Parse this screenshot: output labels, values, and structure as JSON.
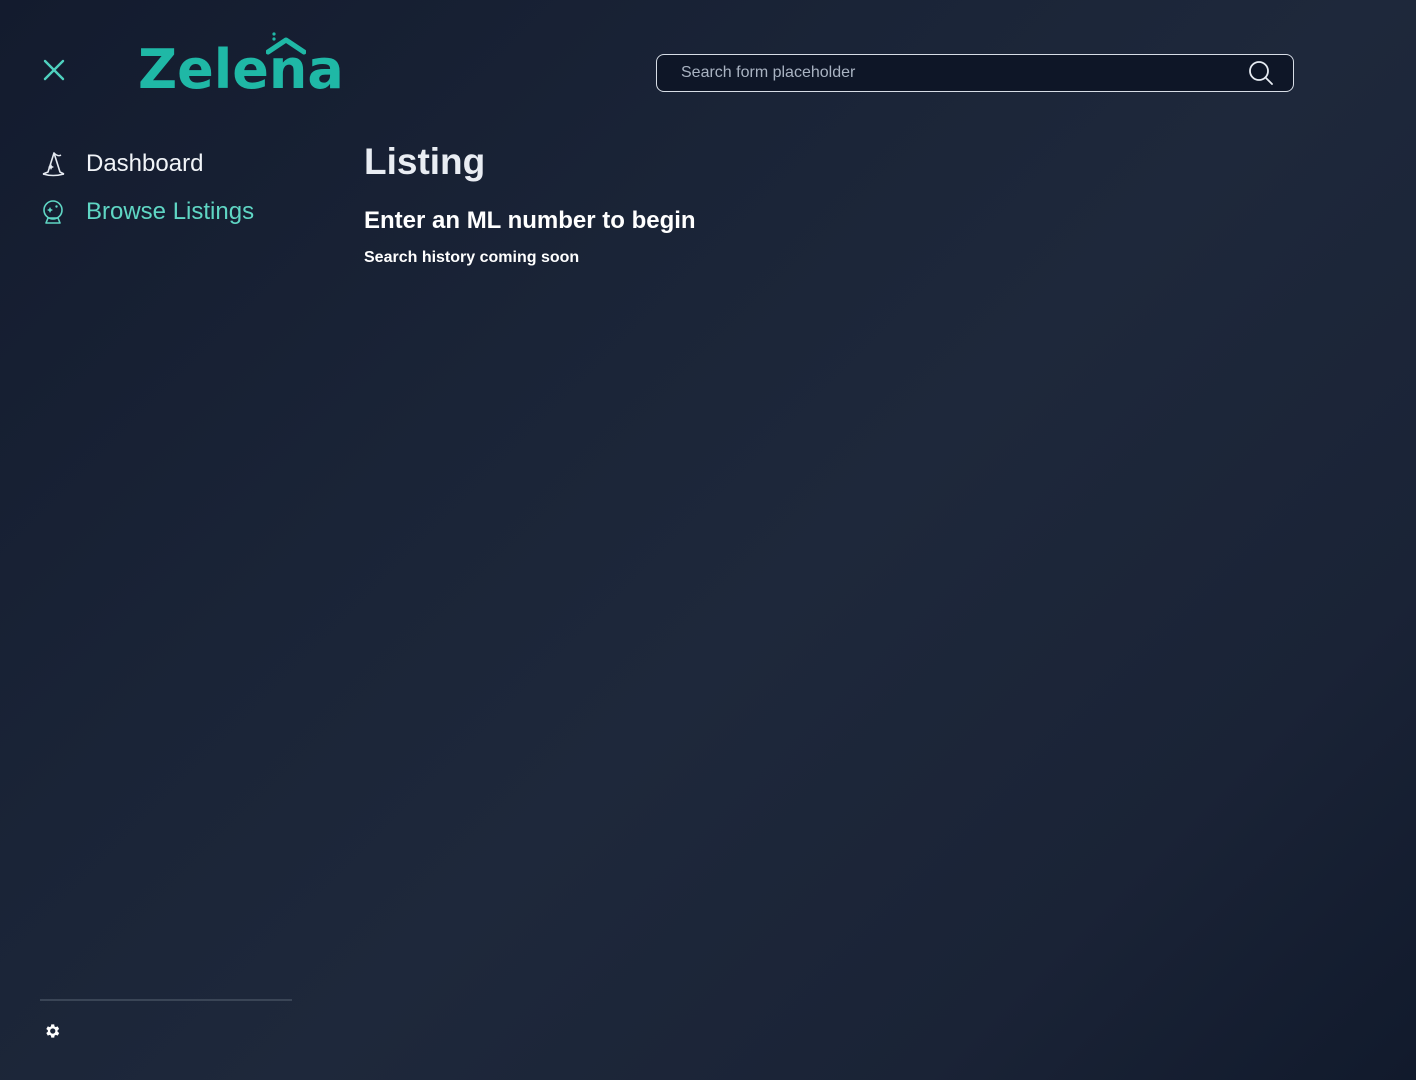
{
  "brand": {
    "name": "Zelena",
    "color": "#1fb8a6"
  },
  "header": {
    "close_icon": "close-icon",
    "search": {
      "placeholder": "Search form placeholder",
      "value": "",
      "icon": "search-icon"
    }
  },
  "sidebar": {
    "items": [
      {
        "label": "Dashboard",
        "icon": "wizard-hat-icon",
        "active": false
      },
      {
        "label": "Browse Listings",
        "icon": "crystal-ball-icon",
        "active": true
      }
    ],
    "active_color": "#5fd6c4",
    "settings_icon": "gear-icon"
  },
  "main": {
    "title": "Listing",
    "heading": "Enter an ML number to begin",
    "subtext": "Search history coming soon"
  }
}
